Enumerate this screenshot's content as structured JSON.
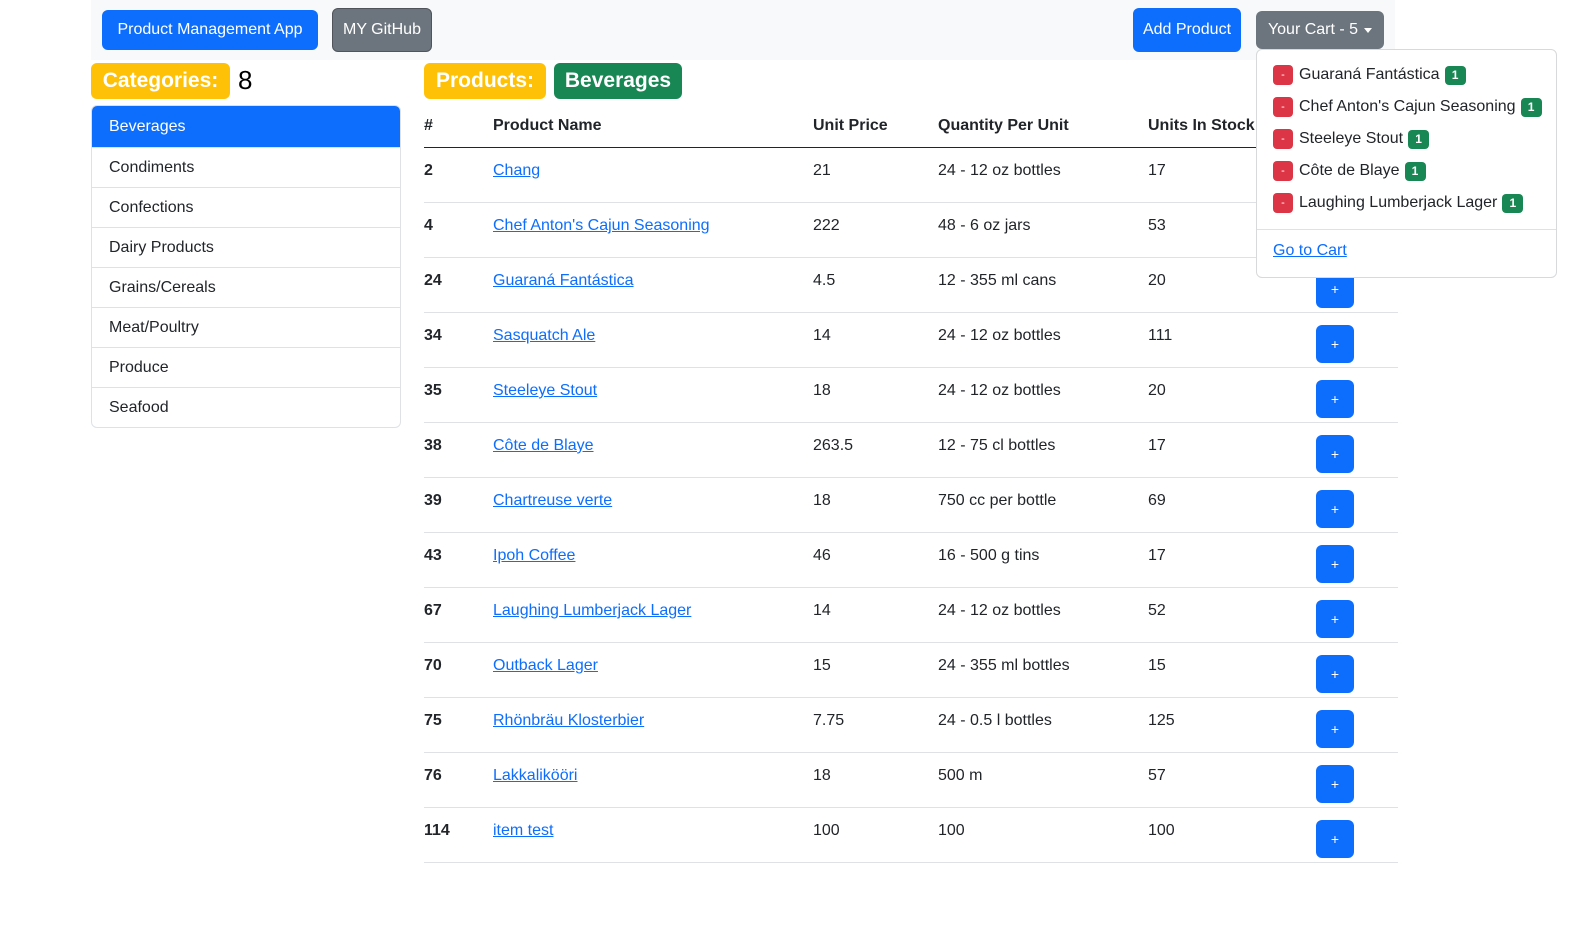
{
  "navbar": {
    "brand": "Product Management App",
    "github": "MY GitHub",
    "add_product": "Add Product",
    "cart_toggle": "Your Cart - 5"
  },
  "categories": {
    "title": "Categories:",
    "count": "8",
    "items": [
      "Beverages",
      "Condiments",
      "Confections",
      "Dairy Products",
      "Grains/Cereals",
      "Meat/Poultry",
      "Produce",
      "Seafood"
    ],
    "active": "Beverages"
  },
  "products": {
    "title": "Products:",
    "category": "Beverages",
    "columns": [
      "#",
      "Product Name",
      "Unit Price",
      "Quantity Per Unit",
      "Units In Stock"
    ],
    "rows": [
      {
        "id": "2",
        "name": "Chang",
        "price": "21",
        "qpu": "24 - 12 oz bottles",
        "stock": "17"
      },
      {
        "id": "4",
        "name": "Chef Anton's Cajun Seasoning",
        "price": "222",
        "qpu": "48 - 6 oz jars",
        "stock": "53"
      },
      {
        "id": "24",
        "name": "Guaraná Fantástica",
        "price": "4.5",
        "qpu": "12 - 355 ml cans",
        "stock": "20"
      },
      {
        "id": "34",
        "name": "Sasquatch Ale",
        "price": "14",
        "qpu": "24 - 12 oz bottles",
        "stock": "111"
      },
      {
        "id": "35",
        "name": "Steeleye Stout",
        "price": "18",
        "qpu": "24 - 12 oz bottles",
        "stock": "20"
      },
      {
        "id": "38",
        "name": "Côte de Blaye",
        "price": "263.5",
        "qpu": "12 - 75 cl bottles",
        "stock": "17"
      },
      {
        "id": "39",
        "name": "Chartreuse verte",
        "price": "18",
        "qpu": "750 cc per bottle",
        "stock": "69"
      },
      {
        "id": "43",
        "name": "Ipoh Coffee",
        "price": "46",
        "qpu": "16 - 500 g tins",
        "stock": "17"
      },
      {
        "id": "67",
        "name": "Laughing Lumberjack Lager",
        "price": "14",
        "qpu": "24 - 12 oz bottles",
        "stock": "52"
      },
      {
        "id": "70",
        "name": "Outback Lager",
        "price": "15",
        "qpu": "24 - 355 ml bottles",
        "stock": "15"
      },
      {
        "id": "75",
        "name": "Rhönbräu Klosterbier",
        "price": "7.75",
        "qpu": "24 - 0.5 l bottles",
        "stock": "125"
      },
      {
        "id": "76",
        "name": "Lakkalikööri",
        "price": "18",
        "qpu": "500 m",
        "stock": "57"
      },
      {
        "id": "114",
        "name": "item test",
        "price": "100",
        "qpu": "100",
        "stock": "100"
      }
    ],
    "add_label": "+"
  },
  "cart": {
    "remove_label": "-",
    "items": [
      {
        "name": "Guaraná Fantástica",
        "qty": "1"
      },
      {
        "name": "Chef Anton's Cajun Seasoning",
        "qty": "1"
      },
      {
        "name": "Steeleye Stout",
        "qty": "1"
      },
      {
        "name": "Côte de Blaye",
        "qty": "1"
      },
      {
        "name": "Laughing Lumberjack Lager",
        "qty": "1"
      }
    ],
    "go_to_cart": "Go to Cart"
  },
  "colors": {
    "primary": "#0d6efd",
    "secondary": "#6c757d",
    "warning": "#ffc107",
    "success": "#198754",
    "danger": "#dc3545"
  }
}
